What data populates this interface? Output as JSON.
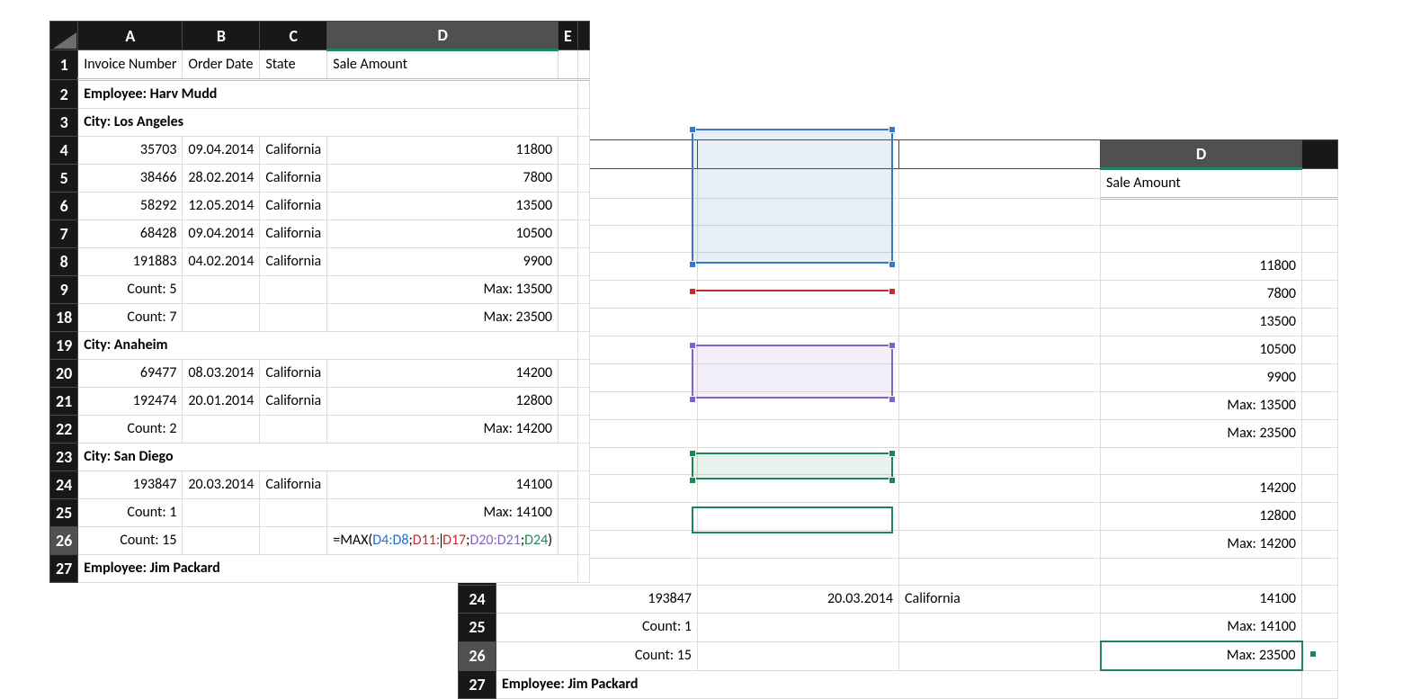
{
  "colsFront": [
    "A",
    "B",
    "C",
    "D",
    "E",
    ""
  ],
  "colsBackD": "D",
  "back": {
    "header": {
      "d_label": "Sale Amount"
    },
    "rows": [
      {
        "n": "24",
        "a": "193847",
        "b": "20.03.2014",
        "c": "California",
        "d": "14100"
      },
      {
        "n": "25",
        "a": "Count: 1",
        "d": "Max: 14100"
      },
      {
        "n": "26",
        "a": "Count: 15",
        "d": "Max: 23500"
      },
      {
        "n": "27",
        "a": "Employee: Jim Packard"
      }
    ],
    "partial_d": [
      "11800",
      "7800",
      "13500",
      "10500",
      "9900",
      "Max: 13500",
      "Max: 23500",
      "",
      "14200",
      "12800",
      "Max: 14200"
    ]
  },
  "front": {
    "header": {
      "a": "Invoice Number",
      "b": "Order Date",
      "c": "State",
      "d": "Sale Amount"
    },
    "rows": [
      {
        "n": "1",
        "a": "Invoice Number",
        "b": "Order Date",
        "c": "State",
        "d": "Sale Amount",
        "type": "head"
      },
      {
        "n": "2",
        "a": "Employee: Harv Mudd",
        "type": "group"
      },
      {
        "n": "3",
        "a": "City: Los Angeles",
        "type": "group"
      },
      {
        "n": "4",
        "a": "35703",
        "b": "09.04.2014",
        "c": "California",
        "d": "11800"
      },
      {
        "n": "5",
        "a": "38466",
        "b": "28.02.2014",
        "c": "California",
        "d": "7800"
      },
      {
        "n": "6",
        "a": "58292",
        "b": "12.05.2014",
        "c": "California",
        "d": "13500"
      },
      {
        "n": "7",
        "a": "68428",
        "b": "09.04.2014",
        "c": "California",
        "d": "10500"
      },
      {
        "n": "8",
        "a": "191883",
        "b": "04.02.2014",
        "c": "California",
        "d": "9900"
      },
      {
        "n": "9",
        "a": "Count: 5",
        "d": "Max: 13500",
        "type": "sum"
      },
      {
        "n": "18",
        "a": "Count: 7",
        "d": "Max: 23500",
        "type": "sum"
      },
      {
        "n": "19",
        "a": "City: Anaheim",
        "type": "group"
      },
      {
        "n": "20",
        "a": "69477",
        "b": "08.03.2014",
        "c": "California",
        "d": "14200"
      },
      {
        "n": "21",
        "a": "192474",
        "b": "20.01.2014",
        "c": "California",
        "d": "12800"
      },
      {
        "n": "22",
        "a": "Count: 2",
        "d": "Max: 14200",
        "type": "sum"
      },
      {
        "n": "23",
        "a": "City: San Diego",
        "type": "group"
      },
      {
        "n": "24",
        "a": "193847",
        "b": "20.03.2014",
        "c": "California",
        "d": "14100"
      },
      {
        "n": "25",
        "a": "Count: 1",
        "d": "Max: 14100",
        "type": "sum"
      },
      {
        "n": "26",
        "a": "Count: 15",
        "type": "formula"
      },
      {
        "n": "27",
        "a": "Employee: Jim Packard",
        "type": "group"
      }
    ],
    "formula": {
      "prefix": "=MAX(",
      "r1": "D4:D8",
      "sep": ";",
      "r2": "D11:D17",
      "r3": "D20:D21",
      "r4": "D24",
      "suffix": ")"
    }
  },
  "colors": {
    "blue": "#3a77c9",
    "red": "#c0302b",
    "purple": "#8063c8",
    "green": "#1d8659",
    "blueFill": "#e7eef8",
    "purpleFill": "#efedf5",
    "greenFill": "#e9f2ec"
  }
}
